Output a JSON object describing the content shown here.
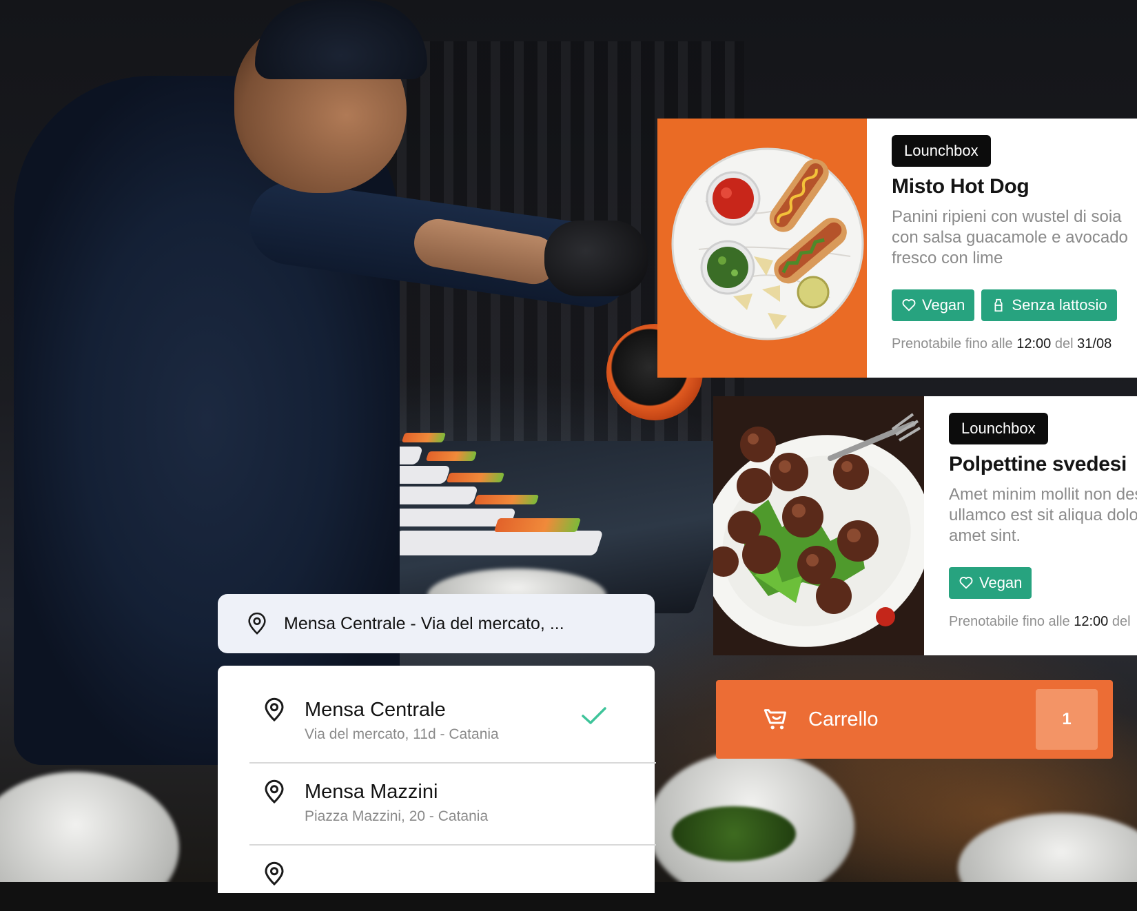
{
  "cards": [
    {
      "badge": "Lounchbox",
      "title": "Misto Hot Dog",
      "description": "Panini ripieni con wustel di soia con salsa guacamole e avocado fresco con lime",
      "tags": [
        "Vegan",
        "Senza lattosio"
      ],
      "deadline_prefix": "Prenotabile fino alle",
      "deadline_time": "12:00",
      "deadline_mid": "del",
      "deadline_date": "31/08"
    },
    {
      "badge": "Lounchbox",
      "title": "Polpettine svedesi",
      "description": "Amet minim mollit non deserunt ullamco est sit aliqua dolor do amet sint.",
      "tags": [
        "Vegan"
      ],
      "deadline_prefix": "Prenotabile fino alle",
      "deadline_time": "12:00",
      "deadline_mid": "del"
    }
  ],
  "location_selector": {
    "current": "Mensa Centrale - Via del mercato, ...",
    "options": [
      {
        "name": "Mensa Centrale",
        "address": "Via del mercato, 11d - Catania",
        "selected": true
      },
      {
        "name": "Mensa Mazzini",
        "address": "Piazza Mazzini, 20 - Catania",
        "selected": false
      }
    ]
  },
  "cart": {
    "label": "Carrello",
    "count": "1"
  },
  "colors": {
    "accent_orange": "#ec6d35",
    "tag_green": "#27a37f",
    "check_green": "#3ec49a"
  },
  "icons": [
    "location-pin-icon",
    "heart-icon",
    "bottle-icon",
    "check-icon",
    "cart-icon"
  ]
}
